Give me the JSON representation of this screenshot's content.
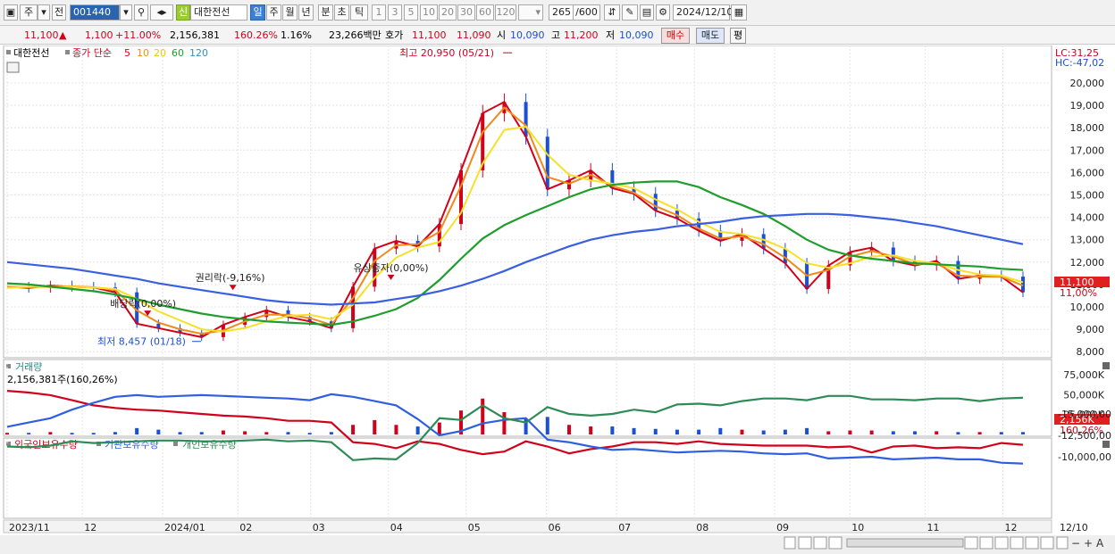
{
  "toolbar": {
    "type_button": "주",
    "prev_button": "전",
    "code_value": "001440",
    "badge_label": "신",
    "stock_name": "대한전선",
    "periods": [
      "일",
      "주",
      "월",
      "년",
      "분",
      "초",
      "틱"
    ],
    "active_period": "일",
    "intervals": [
      "1",
      "3",
      "5",
      "10",
      "20",
      "30",
      "60",
      "120"
    ],
    "count_value": "265",
    "count_total": "/600",
    "date_value": "2024/12/10"
  },
  "quote": {
    "price": "11,100",
    "change": "1,100",
    "change_pct": "+11.00%",
    "volume": "2,156,381",
    "volume_pct": "160.26%",
    "turnover_pct": "1.16%",
    "amount": "23,266백만",
    "bid_ask_label": "호가",
    "ask": "11,100",
    "bid": "11,090",
    "open_label": "시",
    "open": "10,090",
    "high_label": "고",
    "high": "11,200",
    "low_label": "저",
    "low": "10,090",
    "buy_label": "매수",
    "sell_label": "매도",
    "avg_label": "평"
  },
  "colors": {
    "up": "#d0021b",
    "down": "#1a4fd6",
    "ma5": "#d0021b",
    "ma10": "#f08a1c",
    "ma20": "#f5e12a",
    "ma60": "#1f9d2d",
    "ma120": "#3a5fe0",
    "volume_up": "#d0021b",
    "volume_down": "#1a4fd6",
    "foreign": "#d0021b",
    "institution": "#2f5fe0",
    "individual": "#2e8b57"
  },
  "chart_data": [
    {
      "type": "candlestick",
      "title": "대한전선",
      "legend": [
        "종가 단순",
        "5",
        "10",
        "20",
        "60",
        "120"
      ],
      "ylim": [
        8000,
        21000
      ],
      "y_ticks": [
        "20,000",
        "19,000",
        "18,000",
        "17,000",
        "16,000",
        "15,000",
        "14,000",
        "13,000",
        "12,000",
        "11,000",
        "10,000",
        "9,000",
        "8,000"
      ],
      "corner_labels": {
        "lc": "LC:31,25",
        "hc": "HC:-47,02"
      },
      "last_price_label": "11,100",
      "last_pct_label": "11,00%",
      "annotations": [
        {
          "text": "최고 20,950 (05/21)",
          "x": "2024/05/21",
          "y": 20950
        },
        {
          "text": "최저 8,457 (01/18)",
          "x": "2024/01/18",
          "y": 8457
        },
        {
          "text": "권리락(-9,16%)",
          "x": "2024/01/30",
          "y": 10350
        },
        {
          "text": "배당락(0,00%)",
          "x": "2023/12/27",
          "y": 9200
        },
        {
          "text": "유상증자(0,00%)",
          "x": "2024/04/02",
          "y": 10800
        }
      ],
      "series": [
        {
          "name": "5",
          "values": [
            10900,
            10850,
            10950,
            10900,
            10870,
            10650,
            9250,
            9050,
            8850,
            8650,
            9200,
            9550,
            9850,
            9550,
            9350,
            9050,
            10900,
            12600,
            12950,
            12700,
            13700,
            16100,
            18650,
            19150,
            17600,
            15250,
            15650,
            16100,
            15300,
            15050,
            14300,
            13950,
            13400,
            12950,
            13250,
            12600,
            11950,
            10800,
            11850,
            12450,
            12650,
            12050,
            11850,
            12050,
            11250,
            11400,
            11350,
            10650
          ]
        },
        {
          "name": "10",
          "values": [
            10900,
            10880,
            10900,
            10920,
            10880,
            10750,
            9850,
            9300,
            9000,
            8800,
            8950,
            9350,
            9650,
            9650,
            9500,
            9200,
            10400,
            12050,
            12750,
            12800,
            13350,
            15400,
            17800,
            18900,
            18100,
            15800,
            15500,
            15900,
            15400,
            15100,
            14500,
            14100,
            13500,
            13050,
            13150,
            12800,
            12200,
            11400,
            11650,
            12250,
            12500,
            12250,
            11900,
            11950,
            11400,
            11350,
            11350,
            10950
          ]
        },
        {
          "name": "20",
          "values": [
            10850,
            10900,
            10880,
            10900,
            10870,
            10800,
            10350,
            9800,
            9400,
            9000,
            8900,
            9050,
            9350,
            9600,
            9650,
            9450,
            10100,
            11300,
            12200,
            12650,
            12900,
            14200,
            16400,
            17900,
            18050,
            16800,
            15900,
            15650,
            15500,
            15300,
            14800,
            14350,
            13800,
            13350,
            13250,
            13000,
            12600,
            11950,
            11750,
            11950,
            12250,
            12300,
            12050,
            11950,
            11650,
            11450,
            11400,
            11100
          ]
        },
        {
          "name": "60",
          "values": [
            11050,
            11000,
            10900,
            10800,
            10700,
            10550,
            10350,
            10100,
            9900,
            9700,
            9550,
            9450,
            9350,
            9300,
            9250,
            9200,
            9350,
            9600,
            9900,
            10400,
            11200,
            12150,
            13050,
            13650,
            14100,
            14500,
            14900,
            15250,
            15450,
            15550,
            15600,
            15600,
            15350,
            14900,
            14550,
            14150,
            13600,
            13000,
            12550,
            12300,
            12150,
            12050,
            11950,
            11900,
            11850,
            11800,
            11700,
            11650
          ]
        },
        {
          "name": "120",
          "values": [
            12000,
            11900,
            11800,
            11700,
            11550,
            11400,
            11250,
            11050,
            10900,
            10750,
            10600,
            10450,
            10300,
            10200,
            10150,
            10100,
            10150,
            10200,
            10350,
            10500,
            10700,
            10950,
            11250,
            11600,
            12000,
            12350,
            12700,
            13000,
            13200,
            13350,
            13450,
            13600,
            13700,
            13800,
            13950,
            14050,
            14100,
            14150,
            14150,
            14100,
            14000,
            13900,
            13750,
            13600,
            13400,
            13200,
            13000,
            12800
          ]
        }
      ]
    },
    {
      "type": "bar",
      "title": "거래량",
      "readout": "2,156,381주(160,26%)",
      "y_ticks": [
        "75,000K",
        "50,000K",
        "25,000K"
      ],
      "last_label": "2,156K",
      "last_pct_label": "160,26%",
      "values": [
        2,
        2,
        3,
        2,
        2,
        3,
        8,
        6,
        3,
        3,
        5,
        4,
        3,
        3,
        2,
        3,
        12,
        18,
        12,
        10,
        15,
        30,
        45,
        28,
        20,
        22,
        12,
        10,
        10,
        8,
        7,
        6,
        6,
        8,
        6,
        5,
        6,
        8,
        4,
        5,
        5,
        4,
        4,
        4,
        3,
        3,
        3,
        3
      ]
    },
    {
      "type": "line",
      "title": "",
      "legend": [
        "외국인보유수량",
        "기관보유수량",
        "개인보유수량"
      ],
      "y_ticks": [
        "-10,000,00",
        "-12,500,00",
        "-15,000,00"
      ],
      "series": [
        {
          "name": "외국인보유수량",
          "values": [
            -17700,
            -17500,
            -17200,
            -16600,
            -16000,
            -15700,
            -15500,
            -15400,
            -15200,
            -15000,
            -14800,
            -14700,
            -14500,
            -14200,
            -14200,
            -14000,
            -11700,
            -11500,
            -11000,
            -11800,
            -11500,
            -10800,
            -10300,
            -10600,
            -11800,
            -11200,
            -10400,
            -10900,
            -11200,
            -11700,
            -11700,
            -11500,
            -11800,
            -11500,
            -11400,
            -11300,
            -11300,
            -11300,
            -11100,
            -11200,
            -10500,
            -11200,
            -11300,
            -11000,
            -11100,
            -11000,
            -11600,
            -11400
          ]
        },
        {
          "name": "기관보유수량",
          "values": [
            -13500,
            -14000,
            -14500,
            -15500,
            -16300,
            -17000,
            -17200,
            -17000,
            -17100,
            -17200,
            -17100,
            -17000,
            -16900,
            -16800,
            -16600,
            -17300,
            -17000,
            -16500,
            -16000,
            -14400,
            -12500,
            -13000,
            -13900,
            -14300,
            -14500,
            -12000,
            -11700,
            -11200,
            -10800,
            -10900,
            -10700,
            -10500,
            -10600,
            -10700,
            -10600,
            -10400,
            -10300,
            -10400,
            -9800,
            -9900,
            -10000,
            -9700,
            -9800,
            -9900,
            -9700,
            -9700,
            -9300,
            -9200
          ]
        },
        {
          "name": "개인보유수량",
          "values": [
            -11200,
            -11100,
            -11300,
            -11800,
            -11600,
            -11700,
            -11800,
            -11900,
            -11900,
            -11800,
            -11800,
            -11900,
            -12000,
            -11800,
            -11900,
            -11700,
            -9600,
            -9800,
            -9700,
            -11600,
            -14500,
            -14300,
            -16000,
            -14500,
            -14000,
            -15800,
            -15000,
            -14800,
            -15000,
            -15500,
            -15200,
            -16100,
            -16200,
            -16000,
            -16500,
            -16800,
            -16800,
            -16600,
            -17100,
            -17100,
            -16700,
            -16700,
            -16600,
            -16800,
            -16800,
            -16500,
            -16800,
            -16900
          ]
        }
      ]
    }
  ],
  "x_axis": {
    "labels": [
      "2023/11",
      "12",
      "2024/01",
      "02",
      "03",
      "04",
      "05",
      "06",
      "07",
      "08",
      "09",
      "10",
      "11",
      "12",
      "12/10"
    ],
    "label_dates": [
      "2023/11/01",
      "2023/12/01",
      "2024/01/02",
      "2024/02/01",
      "2024/03/01",
      "2024/04/01",
      "2024/05/02",
      "2024/06/03",
      "2024/07/01",
      "2024/08/01",
      "2024/09/02",
      "2024/10/02",
      "2024/11/01",
      "2024/12/02",
      "2024/12/10"
    ]
  }
}
